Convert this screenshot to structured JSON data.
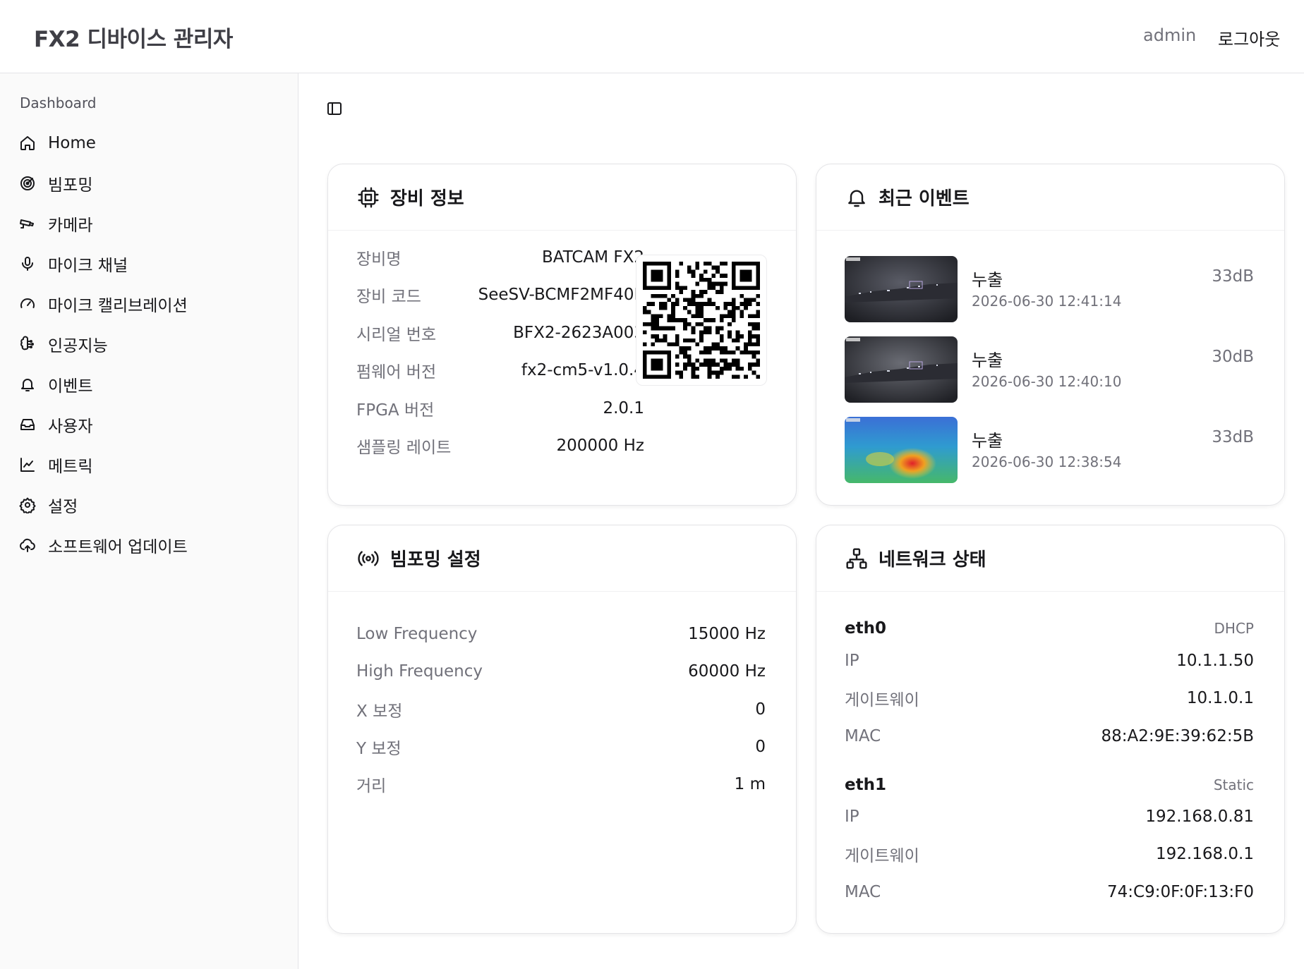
{
  "header": {
    "title": "FX2 디바이스 관리자",
    "user": "admin",
    "logout": "로그아웃"
  },
  "sidebar": {
    "heading": "Dashboard",
    "items": [
      {
        "label": "Home",
        "icon": "home-icon"
      },
      {
        "label": "빔포밍",
        "icon": "radar-icon"
      },
      {
        "label": "카메라",
        "icon": "cctv-icon"
      },
      {
        "label": "마이크 채널",
        "icon": "mic-icon"
      },
      {
        "label": "마이크 캘리브레이션",
        "icon": "gauge-icon"
      },
      {
        "label": "인공지능",
        "icon": "brain-icon"
      },
      {
        "label": "이벤트",
        "icon": "bell-icon"
      },
      {
        "label": "사용자",
        "icon": "inbox-icon"
      },
      {
        "label": "메트릭",
        "icon": "line-chart-icon"
      },
      {
        "label": "설정",
        "icon": "gear-icon"
      },
      {
        "label": "소프트웨어 업데이트",
        "icon": "cloud-upload-icon"
      }
    ]
  },
  "device": {
    "title": "장비 정보",
    "rows": [
      {
        "k": "장비명",
        "v": "BATCAM FX2"
      },
      {
        "k": "장비 코드",
        "v": "SeeSV-BCMF2MF40E"
      },
      {
        "k": "시리얼 번호",
        "v": "BFX2-2623A003"
      },
      {
        "k": "펌웨어 버전",
        "v": "fx2-cm5-v1.0.4"
      },
      {
        "k": "FPGA 버전",
        "v": "2.0.1"
      },
      {
        "k": "샘플링 레이트",
        "v": "200000 Hz"
      }
    ]
  },
  "events": {
    "title": "최근 이벤트",
    "items": [
      {
        "type": "누출",
        "time": "2026-06-30 12:41:14",
        "db": "33dB"
      },
      {
        "type": "누출",
        "time": "2026-06-30 12:40:10",
        "db": "30dB"
      },
      {
        "type": "누출",
        "time": "2026-06-30 12:38:54",
        "db": "33dB"
      }
    ]
  },
  "beam": {
    "title": "빔포밍 설정",
    "rows": [
      {
        "k": "Low Frequency",
        "v": "15000 Hz"
      },
      {
        "k": "High Frequency",
        "v": "60000 Hz"
      },
      {
        "k": "X 보정",
        "v": "0"
      },
      {
        "k": "Y 보정",
        "v": "0"
      },
      {
        "k": "거리",
        "v": "1 m"
      }
    ]
  },
  "network": {
    "title": "네트워크 상태",
    "interfaces": [
      {
        "name": "eth0",
        "mode": "DHCP",
        "rows": [
          {
            "k": "IP",
            "v": "10.1.1.50"
          },
          {
            "k": "게이트웨이",
            "v": "10.1.0.1"
          },
          {
            "k": "MAC",
            "v": "88:A2:9E:39:62:5B"
          }
        ]
      },
      {
        "name": "eth1",
        "mode": "Static",
        "rows": [
          {
            "k": "IP",
            "v": "192.168.0.81"
          },
          {
            "k": "게이트웨이",
            "v": "192.168.0.1"
          },
          {
            "k": "MAC",
            "v": "74:C9:0F:0F:13:F0"
          }
        ]
      }
    ]
  }
}
